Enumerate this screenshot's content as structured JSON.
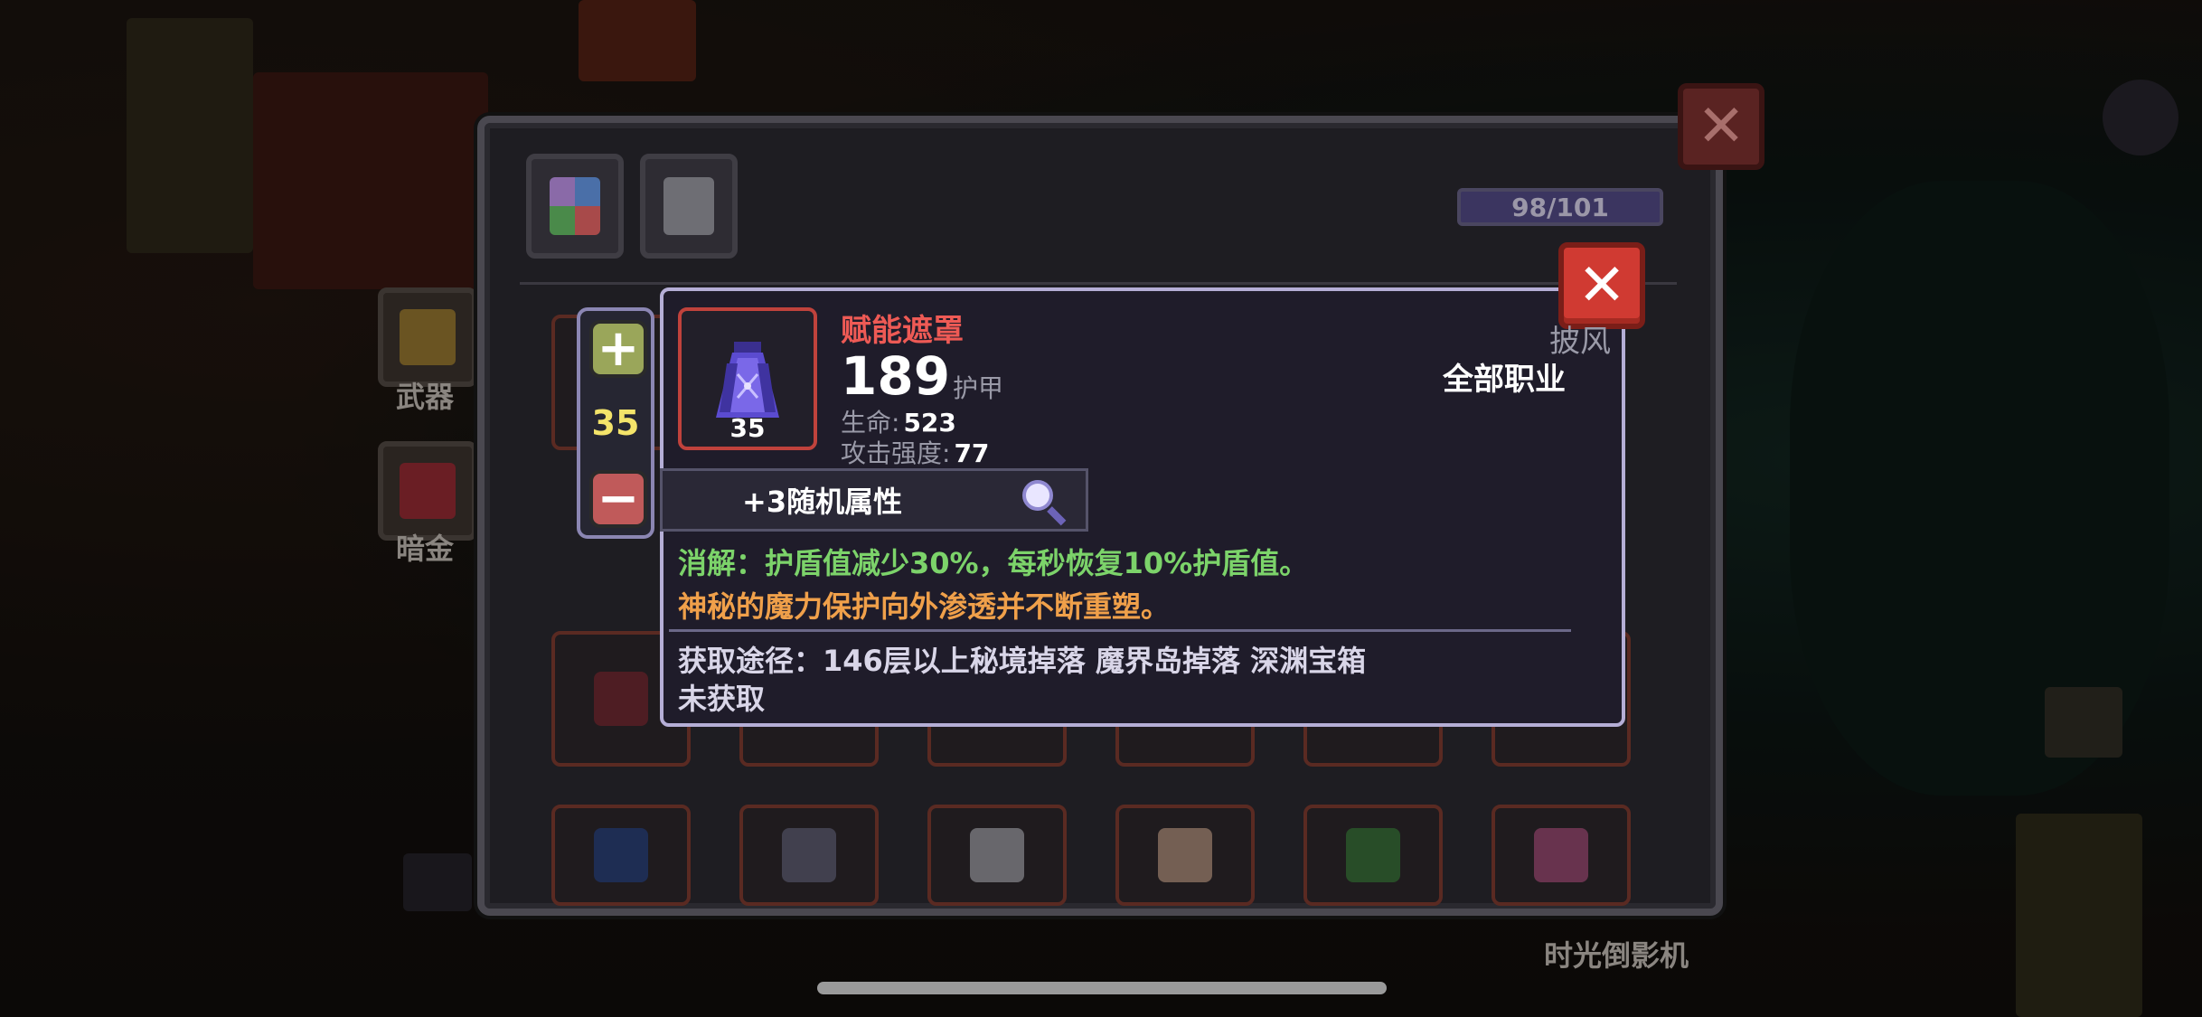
{
  "background": {
    "weapon_label": "武器",
    "dark_gold_label": "暗金",
    "time_machine_label": "时光倒影机"
  },
  "panel": {
    "capacity": "98/101",
    "close_label": "✕"
  },
  "stepper": {
    "plus": "+",
    "minus": "−",
    "level": "35"
  },
  "item": {
    "name": "赋能遮罩",
    "level": "35",
    "armor_value": "189",
    "armor_label": "护甲",
    "stats": [
      {
        "label": "生命:",
        "value": "523"
      },
      {
        "label": "攻击强度:",
        "value": "77"
      }
    ],
    "slot_type": "披风",
    "class_requirement": "全部职业",
    "random_attributes": "+3随机属性",
    "effect": "消解：护盾值减少30%，每秒恢复10%护盾值。",
    "flavor": "神秘的魔力保护向外渗透并不断重塑。",
    "source": "获取途径：146层以上秘境掉落 魔界岛掉落 深渊宝箱",
    "status": "未获取",
    "close_label": "✕",
    "colors": {
      "name": "#ee5a55",
      "effect": "#7cd36a",
      "flavor": "#f0a04a",
      "frame": "#c0423c"
    }
  }
}
